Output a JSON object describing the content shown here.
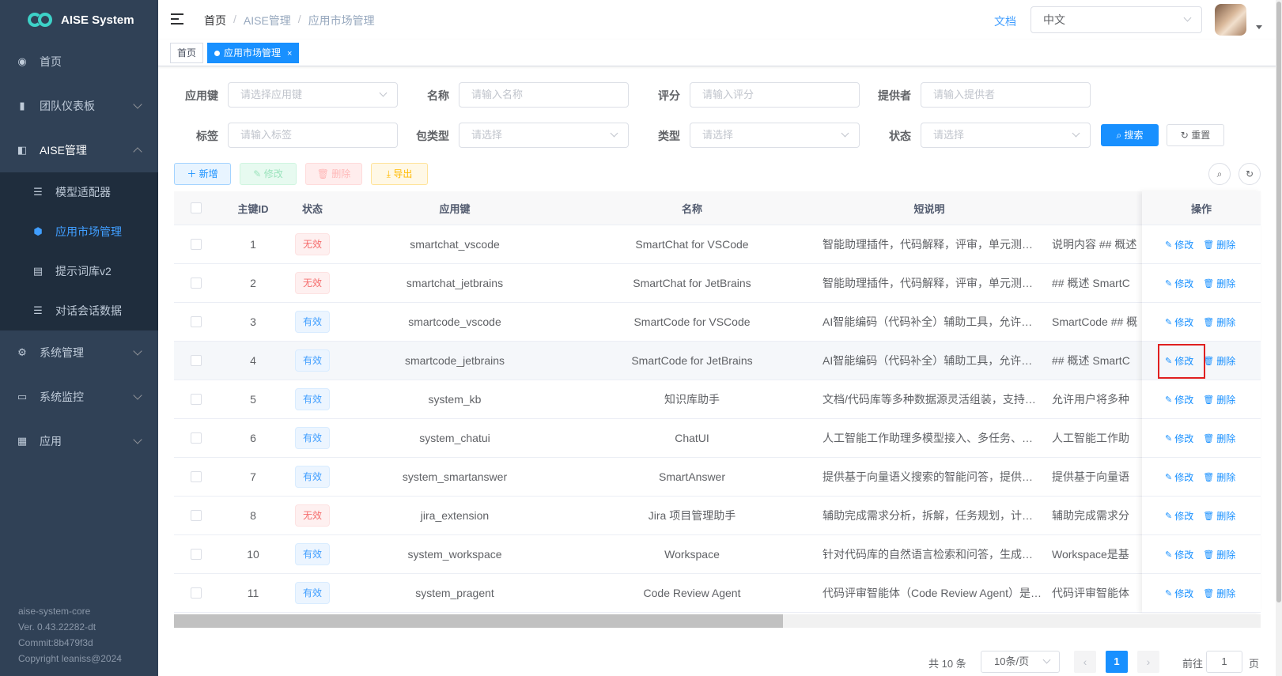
{
  "app": {
    "title": "AISE System"
  },
  "sidebar": {
    "items": [
      {
        "label": "首页",
        "icon": "dashboard-icon"
      },
      {
        "label": "团队仪表板",
        "icon": "bar-chart-icon"
      },
      {
        "label": "AISE管理",
        "icon": "clipboard-icon"
      },
      {
        "label": "系统管理",
        "icon": "gear-icon"
      },
      {
        "label": "系统监控",
        "icon": "monitor-icon"
      },
      {
        "label": "应用",
        "icon": "document-icon"
      }
    ],
    "submenu": [
      {
        "label": "模型适配器",
        "icon": "list-icon"
      },
      {
        "label": "应用市场管理",
        "icon": "shield-icon"
      },
      {
        "label": "提示词库v2",
        "icon": "notebook-icon"
      },
      {
        "label": "对话会话数据",
        "icon": "list-icon"
      }
    ],
    "footer": {
      "core": "aise-system-core",
      "version": "Ver. 0.43.22282-dt",
      "commit": "Commit:8b479f3d",
      "copyright": "Copyright leaniss@2024"
    }
  },
  "header": {
    "breadcrumb": [
      "首页",
      "AISE管理",
      "应用市场管理"
    ],
    "breadcrumb_sep": "/",
    "docs": "文档",
    "language": "中文"
  },
  "tags": {
    "home": "首页",
    "active": "应用市场管理",
    "close": "×"
  },
  "search": {
    "fields": [
      {
        "label": "应用键",
        "placeholder": "请选择应用键"
      },
      {
        "label": "名称",
        "placeholder": "请输入名称"
      },
      {
        "label": "评分",
        "placeholder": "请输入评分"
      },
      {
        "label": "提供者",
        "placeholder": "请输入提供者"
      },
      {
        "label": "标签",
        "placeholder": "请输入标签"
      },
      {
        "label": "包类型",
        "placeholder": "请选择"
      },
      {
        "label": "类型",
        "placeholder": "请选择"
      },
      {
        "label": "状态",
        "placeholder": "请选择"
      }
    ],
    "search_btn": "搜索",
    "reset_btn": "重置"
  },
  "toolbar": {
    "add": "新增",
    "edit": "修改",
    "delete": "删除",
    "export": "导出"
  },
  "table": {
    "headers": {
      "id": "主键ID",
      "status": "状态",
      "app_key": "应用键",
      "name": "名称",
      "short_desc": "短说明",
      "ops": "操作"
    },
    "op_edit": "修改",
    "op_delete": "删除",
    "rows": [
      {
        "id": "1",
        "status": "无效",
        "valid": false,
        "app_key": "smartchat_vscode",
        "name": "SmartChat for VSCode",
        "short_desc": "智能助理插件，代码解释，评审，单元测…",
        "desc": "说明内容 ## 概述"
      },
      {
        "id": "2",
        "status": "无效",
        "valid": false,
        "app_key": "smartchat_jetbrains",
        "name": "SmartChat for JetBrains",
        "short_desc": "智能助理插件，代码解释，评审，单元测…",
        "desc": "## 概述 SmartC"
      },
      {
        "id": "3",
        "status": "有效",
        "valid": true,
        "app_key": "smartcode_vscode",
        "name": "SmartCode for VSCode",
        "short_desc": "AI智能编码（代码补全）辅助工具，允许…",
        "desc": "SmartCode ## 概"
      },
      {
        "id": "4",
        "status": "有效",
        "valid": true,
        "app_key": "smartcode_jetbrains",
        "name": "SmartCode for JetBrains",
        "short_desc": "AI智能编码（代码补全）辅助工具，允许…",
        "desc": "## 概述 SmartC"
      },
      {
        "id": "5",
        "status": "有效",
        "valid": true,
        "app_key": "system_kb",
        "name": "知识库助手",
        "short_desc": "文档/代码库等多种数据源灵活组装，支持…",
        "desc": "允许用户将多种"
      },
      {
        "id": "6",
        "status": "有效",
        "valid": true,
        "app_key": "system_chatui",
        "name": "ChatUI",
        "short_desc": "人工智能工作助理多模型接入、多任务、…",
        "desc": "人工智能工作助"
      },
      {
        "id": "7",
        "status": "有效",
        "valid": true,
        "app_key": "system_smartanswer",
        "name": "SmartAnswer",
        "short_desc": "提供基于向量语义搜索的智能问答，提供…",
        "desc": "提供基于向量语"
      },
      {
        "id": "8",
        "status": "无效",
        "valid": false,
        "app_key": "jira_extension",
        "name": "Jira 项目管理助手",
        "short_desc": "辅助完成需求分析，拆解，任务规划，计…",
        "desc": "辅助完成需求分"
      },
      {
        "id": "10",
        "status": "有效",
        "valid": true,
        "app_key": "system_workspace",
        "name": "Workspace",
        "short_desc": "针对代码库的自然语言检索和问答，生成…",
        "desc": "Workspace是基"
      },
      {
        "id": "11",
        "status": "有效",
        "valid": true,
        "app_key": "system_pragent",
        "name": "Code Review Agent",
        "short_desc": "代码评审智能体（Code Review Agent）是…",
        "desc": "代码评审智能体"
      }
    ]
  },
  "pagination": {
    "total": "共 10 条",
    "page_size": "10条/页",
    "prev": "‹",
    "current": "1",
    "next": "›",
    "goto_label": "前往",
    "goto_value": "1",
    "goto_suffix": "页"
  },
  "colors": {
    "sidebar_bg": "#304156",
    "primary": "#1890ff",
    "danger": "#f56c6c"
  }
}
